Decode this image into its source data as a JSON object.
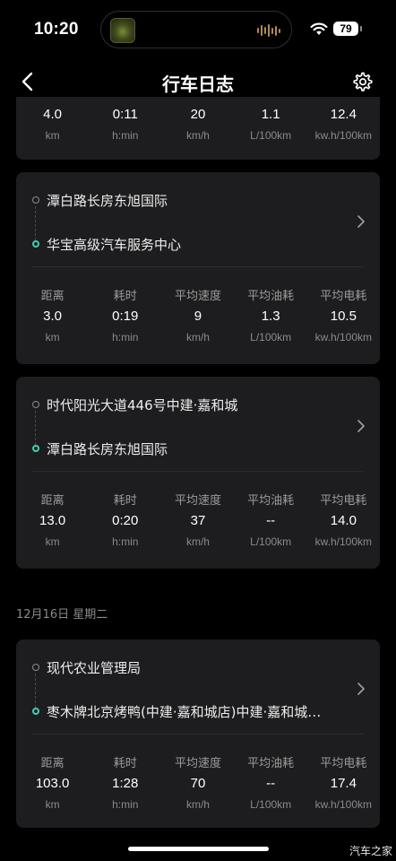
{
  "status_bar": {
    "time": "10:20",
    "battery": "79"
  },
  "nav": {
    "title": "行车日志"
  },
  "stat_labels": {
    "distance": "距离",
    "duration": "耗时",
    "avg_speed": "平均速度",
    "avg_fuel": "平均油耗",
    "avg_power": "平均电耗"
  },
  "units": {
    "km": "km",
    "hmin": "h:min",
    "kmh": "km/h",
    "l100": "L/100km",
    "kwh100": "kw.h/100km"
  },
  "trips": [
    {
      "distance": "4.0",
      "duration": "0:11",
      "avg_speed": "20",
      "avg_fuel": "1.1",
      "avg_power": "12.4"
    },
    {
      "from": "潭白路长房东旭国际",
      "to": "华宝高级汽车服务中心",
      "distance": "3.0",
      "duration": "0:19",
      "avg_speed": "9",
      "avg_fuel": "1.3",
      "avg_power": "10.5"
    },
    {
      "from": "时代阳光大道446号中建·嘉和城",
      "to": "潭白路长房东旭国际",
      "distance": "13.0",
      "duration": "0:20",
      "avg_speed": "37",
      "avg_fuel": "-- ",
      "avg_power": "14.0"
    },
    {
      "from": "现代农业管理局",
      "to": "枣木牌北京烤鸭(中建·嘉和城店)中建·嘉和城…",
      "distance": "103.0",
      "duration": "1:28",
      "avg_speed": "70",
      "avg_fuel": "--",
      "avg_power": "17.4"
    }
  ],
  "date_header": "12月16日  星期二",
  "watermark": "汽车之家"
}
